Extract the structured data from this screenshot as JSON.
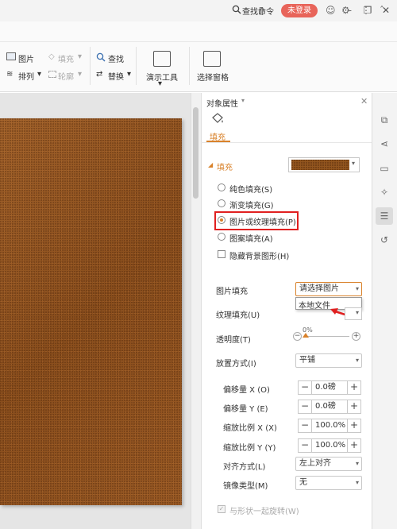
{
  "titlebar": {
    "login_label": "未登录"
  },
  "cmdbar": {
    "search_label": "查找命令"
  },
  "ribbon": {
    "picture": "图片",
    "fill": "填充",
    "arrange": "排列",
    "outline": "轮廓",
    "find": "查找",
    "replace": "替换",
    "presentation_tools": "演示工具",
    "selection_pane": "选择窗格"
  },
  "pane": {
    "title": "对象属性",
    "tab_fill": "填充",
    "section_fill": "填充",
    "fill_options": [
      {
        "label": "纯色填充(S)",
        "selected": false
      },
      {
        "label": "渐变填充(G)",
        "selected": false
      },
      {
        "label": "图片或纹理填充(P)",
        "selected": true
      },
      {
        "label": "图案填充(A)",
        "selected": false
      }
    ],
    "hide_bg_label": "隐藏背景图形(H)",
    "picture_fill_label": "图片填充",
    "picture_fill_value": "请选择图片",
    "picture_fill_option": "本地文件",
    "texture_fill_label": "纹理填充(U)",
    "transparency_label": "透明度(T)",
    "transparency_value": "0%",
    "placement_label": "放置方式(I)",
    "placement_value": "平铺",
    "offset_x_label": "偏移量 X (O)",
    "offset_x_value": "0.0磅",
    "offset_y_label": "偏移量 Y (E)",
    "offset_y_value": "0.0磅",
    "scale_x_label": "缩放比例 X (X)",
    "scale_x_value": "100.0%",
    "scale_y_label": "缩放比例 Y (Y)",
    "scale_y_value": "100.0%",
    "align_label": "对齐方式(L)",
    "align_value": "左上对齐",
    "mirror_label": "镜像类型(M)",
    "mirror_value": "无",
    "rotate_label": "与形状一起旋转(W)"
  },
  "colors": {
    "accent": "#d9822b",
    "highlight_box": "#e02020",
    "login_bg": "#e8645a",
    "leather": "#93561f"
  }
}
